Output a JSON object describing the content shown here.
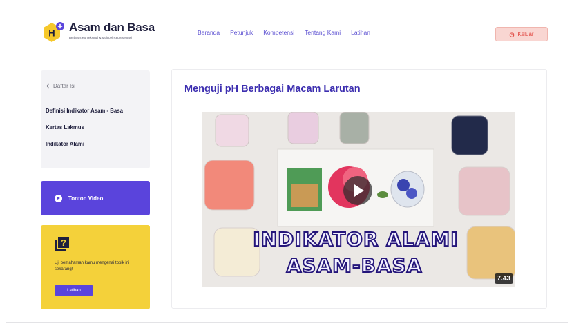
{
  "header": {
    "brand_title": "Asam dan Basa",
    "brand_subtitle": "Berbasis Kontekstual & Multipel Representasi",
    "logo_letter": "H",
    "nav": [
      "Beranda",
      "Petunjuk",
      "Kompetensi",
      "Tentang Kami",
      "Latihan"
    ],
    "logout_label": "Keluar",
    "accent": "#5a44dc",
    "logout_color": "#e0413a"
  },
  "sidebar": {
    "back_label": "Daftar Isi",
    "items": [
      "Definisi Indikator Asam - Basa",
      "Kertas Lakmus",
      "Indikator Alami"
    ],
    "watch_label": "Tonton Video",
    "quiz_text": "Uji pemahaman kamu mengenai topik ini sekarang!",
    "quiz_button": "Latihan",
    "quiz_bg": "#f4d13a"
  },
  "main": {
    "title": "Menguji pH Berbagai Macam Larutan",
    "video": {
      "overlay_line1": "INDIKATOR ALAMI",
      "overlay_line2": "ASAM-BASA",
      "duration": "7.43"
    }
  }
}
